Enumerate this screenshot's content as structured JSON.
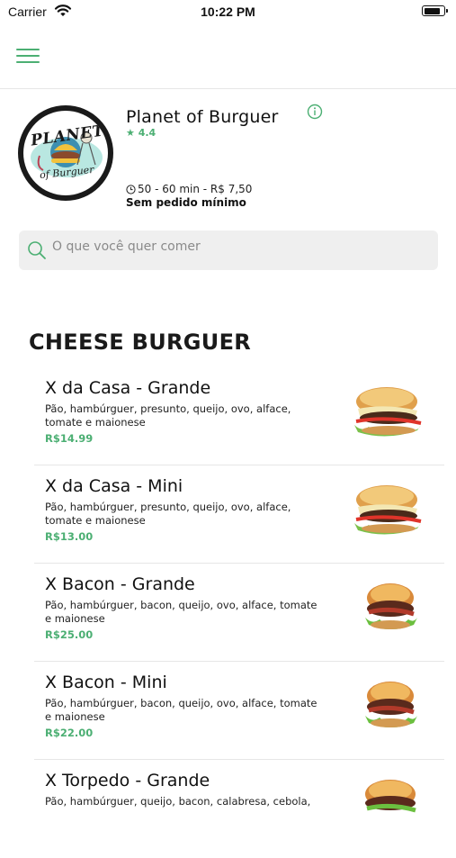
{
  "status_bar": {
    "carrier": "Carrier",
    "time": "10:22 PM"
  },
  "header": {
    "menu_icon": "hamburger-menu-icon"
  },
  "store": {
    "logo_text_top": "PLANET",
    "logo_text_bottom": "of Burguer",
    "name": "Planet of Burguer",
    "rating": "4.4",
    "delivery_info": "50 - 60 min - R$ 7,50",
    "minimum_order": "Sem pedido mínimo"
  },
  "search": {
    "placeholder": "O que você quer comer"
  },
  "category": {
    "title": "CHEESE BURGUER"
  },
  "items": [
    {
      "name": "X da Casa - Grande",
      "description": "Pão, hambúrguer, presunto, queijo, ovo, alface, tomate e maionese",
      "price": "R$14.99"
    },
    {
      "name": "X da Casa - Mini",
      "description": "Pão, hambúrguer, presunto, queijo, ovo, alface, tomate e maionese",
      "price": "R$13.00"
    },
    {
      "name": "X Bacon - Grande",
      "description": "Pão, hambúrguer, bacon, queijo, ovo, alface, tomate e maionese",
      "price": "R$25.00"
    },
    {
      "name": "X Bacon - Mini",
      "description": "Pão, hambúrguer, bacon, queijo, ovo, alface, tomate e maionese",
      "price": "R$22.00"
    },
    {
      "name": "X Torpedo - Grande",
      "description": "Pão, hambúrguer, queijo, bacon, calabresa, cebola,",
      "price": ""
    }
  ],
  "colors": {
    "accent": "#4caf73"
  }
}
